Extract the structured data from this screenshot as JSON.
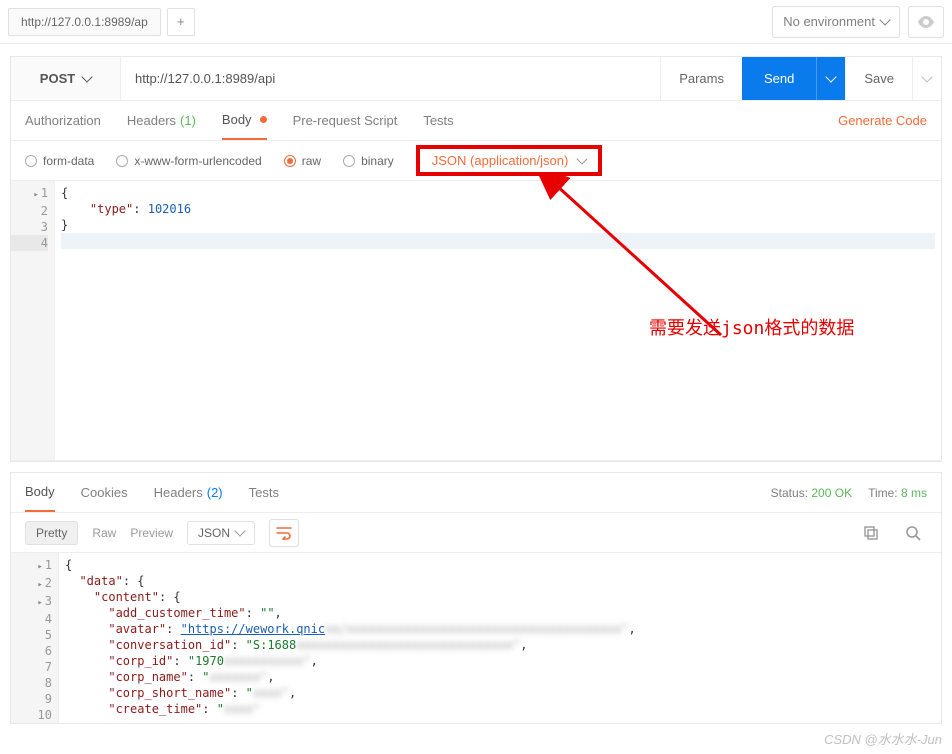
{
  "topbar": {
    "tab_title": "http://127.0.0.1:8989/ap",
    "env_label": "No environment"
  },
  "request": {
    "method": "POST",
    "url": "http://127.0.0.1:8989/api",
    "params_label": "Params",
    "send_label": "Send",
    "save_label": "Save"
  },
  "req_tabs": {
    "authorization": "Authorization",
    "headers": "Headers",
    "headers_count": "(1)",
    "body": "Body",
    "prerequest": "Pre-request Script",
    "tests": "Tests",
    "generate_code": "Generate Code"
  },
  "body_type": {
    "formdata": "form-data",
    "urlencoded": "x-www-form-urlencoded",
    "raw": "raw",
    "binary": "binary",
    "content_type": "JSON (application/json)"
  },
  "request_body": {
    "lines": {
      "l1": "{",
      "l2_key": "\"type\"",
      "l2_sep": ": ",
      "l2_val": "102016",
      "l3": "}"
    }
  },
  "annotation": {
    "text": "需要发送json格式的数据"
  },
  "resp_tabs": {
    "body": "Body",
    "cookies": "Cookies",
    "headers": "Headers",
    "headers_count": "(2)",
    "tests": "Tests"
  },
  "resp_status": {
    "status_label": "Status:",
    "status_value": "200 OK",
    "time_label": "Time:",
    "time_value": "8 ms"
  },
  "resp_toolbar": {
    "pretty": "Pretty",
    "raw": "Raw",
    "preview": "Preview",
    "format": "JSON"
  },
  "response_body": {
    "keys": {
      "data": "\"data\"",
      "content": "\"content\"",
      "add_customer_time": "\"add_customer_time\"",
      "avatar": "\"avatar\"",
      "conversation_id": "\"conversation_id\"",
      "corp_id": "\"corp_id\"",
      "corp_name": "\"corp_name\"",
      "corp_short_name": "\"corp_short_name\"",
      "create_time": "\"create_time\""
    },
    "vals": {
      "empty": "\"\"",
      "avatar": "\"https://wework.qnic",
      "conversation_id": "\"S:1688",
      "corp_id": "\"1970",
      "corp_name": "\"",
      "corp_short_name": "\"",
      "create_time": "\""
    }
  },
  "watermark": "CSDN @水水水-Jun"
}
